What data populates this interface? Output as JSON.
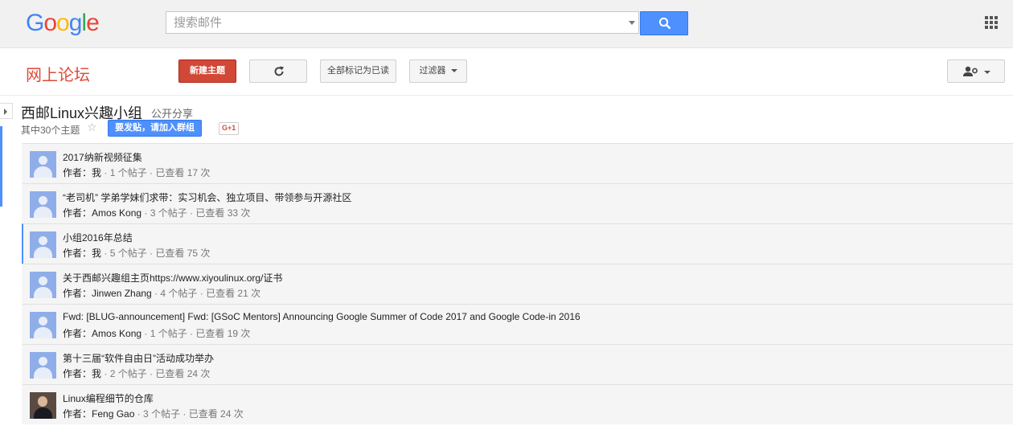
{
  "header": {
    "logo": [
      "G",
      "o",
      "o",
      "g",
      "l",
      "e"
    ],
    "logo_colors": [
      "#4285f4",
      "#ea4335",
      "#fbbc05",
      "#4285f4",
      "#34a853",
      "#ea4335"
    ],
    "search_placeholder": "搜索邮件"
  },
  "toolbar": {
    "forum_title": "网上论坛",
    "new_topic": "新建主题",
    "mark_all_read": "全部标记为已读",
    "filter": "过滤器"
  },
  "group": {
    "name": "西邮Linux兴趣小组",
    "share": "公开分享",
    "topic_count": "其中30个主题",
    "join_button": "要发贴，请加入群组",
    "gplus": "G+1"
  },
  "topics": [
    {
      "title": "2017纳新视频征集",
      "author_prefix": "作者：",
      "author": "我",
      "stats": " · 1 个帖子 · 已查看 17 次",
      "avatar": "default"
    },
    {
      "title": "“老司机” 学弟学妹们求带：实习机会、独立项目、带领参与开源社区",
      "author_prefix": "作者：",
      "author": "Amos Kong",
      "stats": " · 3 个帖子 · 已查看 33 次",
      "avatar": "default"
    },
    {
      "title": "小组2016年总结",
      "author_prefix": "作者：",
      "author": "我",
      "stats": " · 5 个帖子 · 已查看 75 次",
      "avatar": "default"
    },
    {
      "title": "关于西邮兴趣组主页https://www.xiyoulinux.org/证书",
      "author_prefix": "作者：",
      "author": "Jinwen Zhang",
      "stats": " · 4 个帖子 · 已查看 21 次",
      "avatar": "default"
    },
    {
      "title": "Fwd: [BLUG-announcement] Fwd: [GSoC Mentors] Announcing Google Summer of Code 2017 and Google Code-in 2016",
      "author_prefix": "作者：",
      "author": "Amos Kong",
      "stats": " · 1 个帖子 · 已查看 19 次",
      "avatar": "default"
    },
    {
      "title": "第十三届“软件自由日”活动成功举办",
      "author_prefix": "作者：",
      "author": "我",
      "stats": " · 2 个帖子 · 已查看 24 次",
      "avatar": "default"
    },
    {
      "title": "Linux编程细节的仓库",
      "author_prefix": "作者：",
      "author": "Feng Gao",
      "stats": " · 3 个帖子 · 已查看 24 次",
      "avatar": "photo"
    }
  ]
}
